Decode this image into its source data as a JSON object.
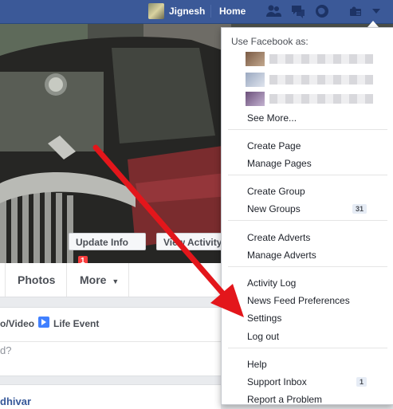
{
  "topbar": {
    "user_name": "Jignesh",
    "home": "Home",
    "icons": [
      "friend-requests-icon",
      "messages-icon",
      "notifications-icon",
      "privacy-shortcuts-icon",
      "account-menu-icon"
    ]
  },
  "cover": {
    "update_info_label": "Update Info",
    "update_info_badge": "1",
    "view_activity_label": "View Activity"
  },
  "tabs": {
    "photos": "Photos",
    "more": "More"
  },
  "composer": {
    "photo_video": "o/Video",
    "life_event": "Life Event",
    "placeholder": "d?"
  },
  "post": {
    "author": "dhivar"
  },
  "menu": {
    "header": "Use Facebook as:",
    "see_more": "See More...",
    "groups": [
      [
        "Create Page",
        "Manage Pages"
      ],
      [
        "Create Group",
        "New Groups"
      ],
      [
        "Create Adverts",
        "Manage Adverts"
      ],
      [
        "Activity Log",
        "News Feed Preferences",
        "Settings",
        "Log out"
      ],
      [
        "Help",
        "Support Inbox",
        "Report a Problem"
      ]
    ],
    "new_groups_count": "31",
    "support_inbox_count": "1"
  }
}
